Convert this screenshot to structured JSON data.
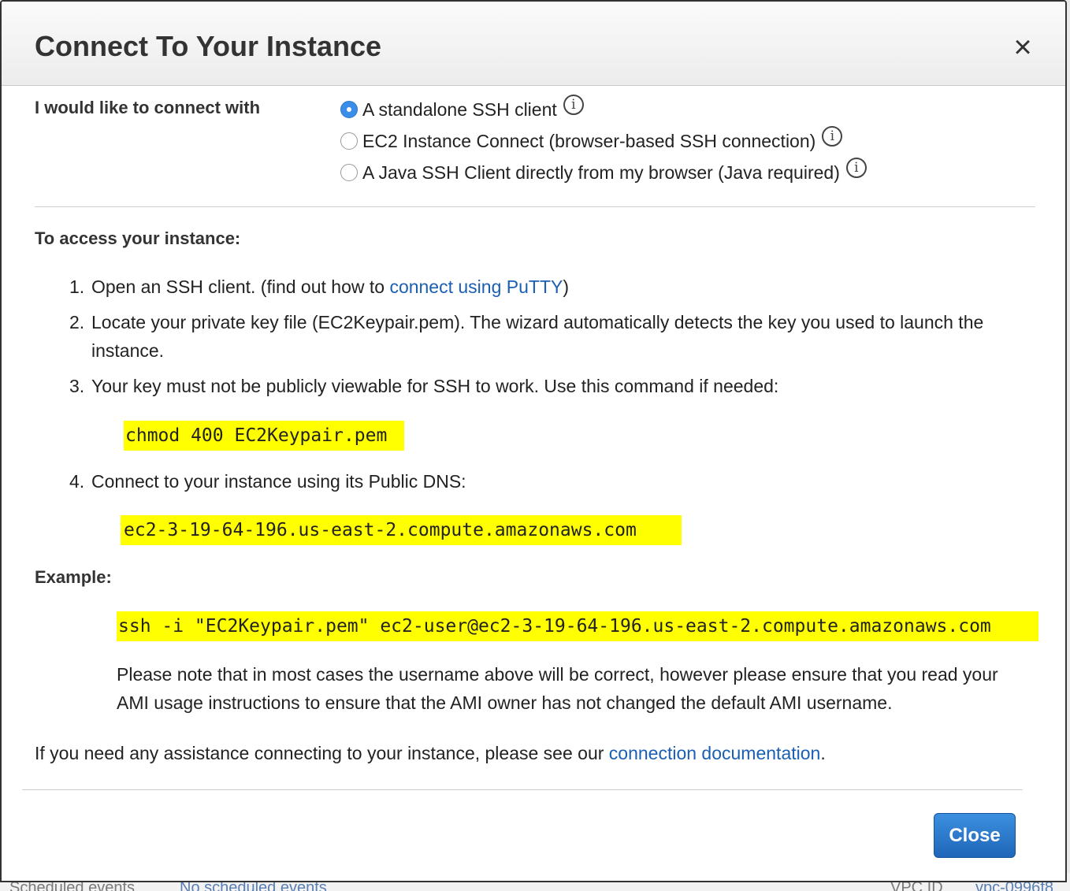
{
  "dialog": {
    "title": "Connect To Your Instance",
    "close_icon": "×",
    "connect_with_label": "I would like to connect with",
    "options": [
      {
        "label": "A standalone SSH client",
        "checked": true,
        "info_icon": "i"
      },
      {
        "label": "EC2 Instance Connect (browser-based SSH connection)",
        "checked": false,
        "info_icon": "i"
      },
      {
        "label": "A Java SSH Client directly from my browser (Java required)",
        "checked": false,
        "info_icon": "i"
      }
    ],
    "access_heading": "To access your instance:",
    "steps": {
      "s1_num": "1.",
      "s1_text": "Open an SSH client. (find out how to ",
      "s1_link": "connect using PuTTY",
      "s1_after": ")",
      "s2_num": "2.",
      "s2_line1": "Locate your private key file (EC2Keypair.pem). The wizard automatically detects the key you used to launch the",
      "s2_line2": "instance.",
      "s3_num": "3.",
      "s3_text": "Your key must not be publicly viewable for SSH to work. Use this command if needed:",
      "s3_command": "chmod 400 EC2Keypair.pem",
      "s4_num": "4.",
      "s4_text": "Connect to your instance using its Public DNS:",
      "s4_dns": "ec2-3-19-64-196.us-east-2.compute.amazonaws.com"
    },
    "example_heading": "Example:",
    "example_command": "ssh -i \"EC2Keypair.pem\" ec2-user@ec2-3-19-64-196.us-east-2.compute.amazonaws.com",
    "note": "Please note that in most cases the username above will be correct, however please ensure that you read your AMI usage instructions to ensure that the AMI owner has not changed the default AMI username.",
    "assist_text": "If you need any assistance connecting to your instance, please see our ",
    "assist_link": "connection documentation",
    "assist_after": ".",
    "close_button": "Close"
  },
  "background": {
    "scheduled_events_label": "Scheduled events",
    "scheduled_events_value": "No scheduled events",
    "vpc_label": "VPC ID",
    "vpc_value": "vpc-0996f8"
  },
  "colors": {
    "highlight": "#ffff00",
    "link": "#1a5fb4",
    "primary_button": "#2a7ad0",
    "radio_checked": "#3a8de8"
  }
}
